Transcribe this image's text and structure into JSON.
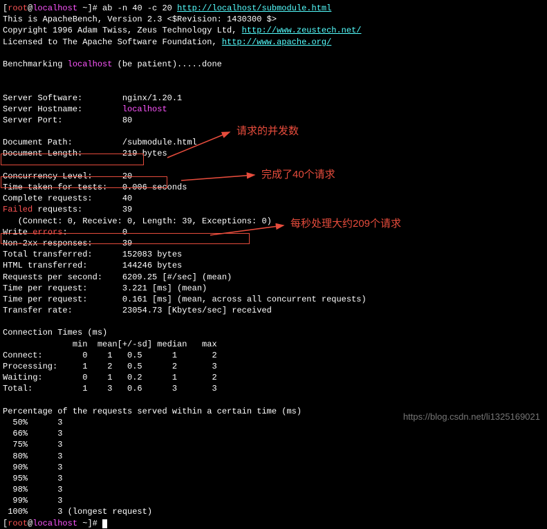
{
  "prompt": {
    "user": "root",
    "at": "@",
    "host": "localhost",
    "dir": " ~",
    "hash": "]# ",
    "cmd": "ab -n 40 -c 20 ",
    "url": "http://localhost/submodule.html"
  },
  "header": {
    "l1": "This is ApacheBench, Version 2.3 <$Revision: 1430300 $>",
    "l2a": "Copyright 1996 Adam Twiss, Zeus Technology Ltd, ",
    "l2b": "http://www.zeustech.net/",
    "l3a": "Licensed to The Apache Software Foundation, ",
    "l3b": "http://www.apache.org/"
  },
  "bench": {
    "pre": "Benchmarking ",
    "host": "localhost",
    "post": " (be patient).....done"
  },
  "server": {
    "software_label": "Server Software:        ",
    "software": "nginx/1.20.1",
    "hostname_label": "Server Hostname:        ",
    "hostname": "localhost",
    "port_label": "Server Port:            ",
    "port": "80"
  },
  "doc": {
    "path_label": "Document Path:          ",
    "path": "/submodule.html",
    "length_label": "Document Length:        ",
    "length": "219 bytes"
  },
  "stats": {
    "concurrency_label": "Concurrency Level:      ",
    "concurrency": "20",
    "time_tests_label": "Time taken for tests:   ",
    "time_tests": "0.006 seconds",
    "complete_label": "Complete requests:      ",
    "complete": "40",
    "failed_pre": "Failed",
    "failed_mid": " requests:        ",
    "failed": "39",
    "failed_detail": "   (Connect: 0, Receive: 0, Length: 39, Exceptions: 0)",
    "write_pre": "Write ",
    "write_err": "errors",
    "write_post": ":           0",
    "non2xx": "Non-2xx responses:      39",
    "total_transferred": "Total transferred:      152083 bytes",
    "html_transferred": "HTML transferred:       144246 bytes",
    "rps_label": "Requests per second:    ",
    "rps": "6209.25 [#/sec] (mean)",
    "tpr1": "Time per request:       3.221 [ms] (mean)",
    "tpr2": "Time per request:       0.161 [ms] (mean, across all concurrent requests)",
    "transfer_rate": "Transfer rate:          23054.73 [Kbytes/sec] received"
  },
  "conn_times": {
    "title": "Connection Times (ms)",
    "header": "              min  mean[+/-sd] median   max",
    "connect": "Connect:        0    1   0.5      1       2",
    "processing": "Processing:     1    2   0.5      2       3",
    "waiting": "Waiting:        0    1   0.2      1       2",
    "total": "Total:          1    3   0.6      3       3"
  },
  "percentiles": {
    "title": "Percentage of the requests served within a certain time (ms)",
    "p50": "  50%      3",
    "p66": "  66%      3",
    "p75": "  75%      3",
    "p80": "  80%      3",
    "p90": "  90%      3",
    "p95": "  95%      3",
    "p98": "  98%      3",
    "p99": "  99%      3",
    "p100": " 100%      3 (longest request)"
  },
  "annotations": {
    "a1": "请求的并发数",
    "a2": "完成了40个请求",
    "a3": "每秒处理大约209个请求"
  },
  "watermark": "https://blog.csdn.net/li1325169021",
  "chart_data": {
    "type": "table",
    "title": "ApacheBench result",
    "command": "ab -n 40 -c 20 http://localhost/submodule.html",
    "server_software": "nginx/1.20.1",
    "server_hostname": "localhost",
    "server_port": 80,
    "document_path": "/submodule.html",
    "document_length_bytes": 219,
    "concurrency_level": 20,
    "time_taken_seconds": 0.006,
    "complete_requests": 40,
    "failed_requests": 39,
    "failed_breakdown": {
      "connect": 0,
      "receive": 0,
      "length": 39,
      "exceptions": 0
    },
    "write_errors": 0,
    "non_2xx_responses": 39,
    "total_transferred_bytes": 152083,
    "html_transferred_bytes": 144246,
    "requests_per_second": 6209.25,
    "time_per_request_ms_mean": 3.221,
    "time_per_request_ms_mean_all": 0.161,
    "transfer_rate_kbytes_sec": 23054.73,
    "connection_times_ms": {
      "columns": [
        "min",
        "mean",
        "sd",
        "median",
        "max"
      ],
      "Connect": [
        0,
        1,
        0.5,
        1,
        2
      ],
      "Processing": [
        1,
        2,
        0.5,
        2,
        3
      ],
      "Waiting": [
        0,
        1,
        0.2,
        1,
        2
      ],
      "Total": [
        1,
        3,
        0.6,
        3,
        3
      ]
    },
    "percentiles_ms": {
      "50": 3,
      "66": 3,
      "75": 3,
      "80": 3,
      "90": 3,
      "95": 3,
      "98": 3,
      "99": 3,
      "100": 3
    }
  }
}
